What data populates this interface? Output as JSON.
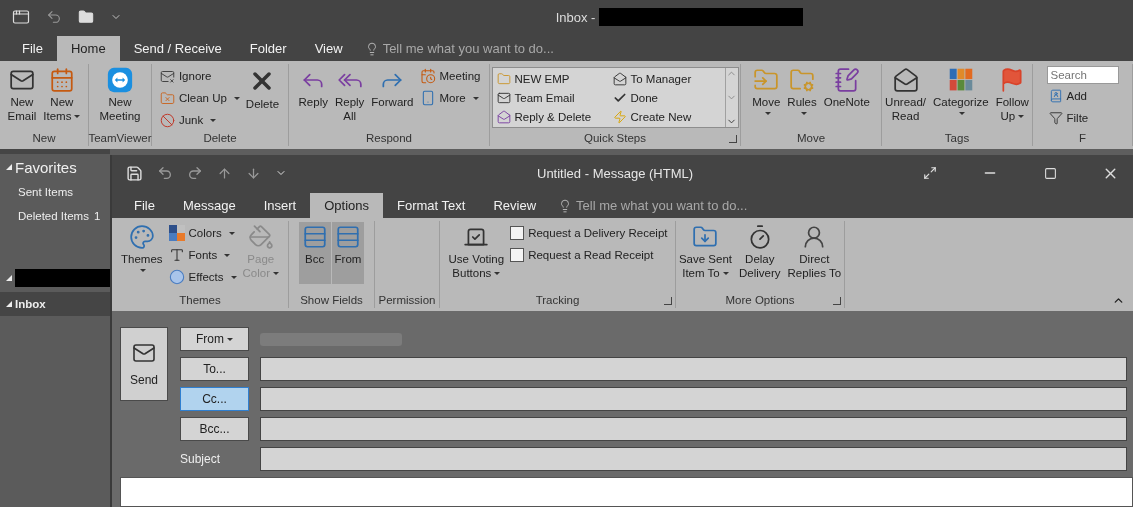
{
  "main_window": {
    "title": "Inbox -",
    "tabs": [
      {
        "label": "File",
        "selected": false
      },
      {
        "label": "Home",
        "selected": true
      },
      {
        "label": "Send / Receive",
        "selected": false
      },
      {
        "label": "Folder",
        "selected": false
      },
      {
        "label": "View",
        "selected": false
      }
    ],
    "tell_me": {
      "placeholder": "Tell me what you want to do..."
    },
    "ribbon": [
      {
        "label": "New",
        "items": [
          {
            "kind": "large",
            "label": "New\nEmail",
            "dropdown": false
          },
          {
            "kind": "large",
            "label": "New\nItems",
            "dropdown": true
          }
        ]
      },
      {
        "label": "TeamViewer",
        "items": [
          {
            "kind": "large",
            "label": "New\nMeeting",
            "dropdown": false
          }
        ]
      },
      {
        "label": "Delete",
        "items": [
          {
            "kind": "stack",
            "items": [
              {
                "label": "Ignore",
                "dropdown": false
              },
              {
                "label": "Clean Up",
                "dropdown": true
              },
              {
                "label": "Junk",
                "dropdown": true
              }
            ]
          },
          {
            "kind": "large",
            "label": "Delete",
            "dropdown": false
          }
        ]
      },
      {
        "label": "Respond",
        "items": [
          {
            "kind": "large",
            "label": "Reply",
            "dropdown": false
          },
          {
            "kind": "large",
            "label": "Reply\nAll",
            "dropdown": false
          },
          {
            "kind": "large",
            "label": "Forward",
            "dropdown": false
          },
          {
            "kind": "stack",
            "items": [
              {
                "label": "Meeting",
                "dropdown": false
              },
              {
                "label": "More",
                "dropdown": true
              }
            ]
          }
        ]
      },
      {
        "label": "Quick Steps",
        "launcher": true,
        "items": [
          {
            "kind": "gallery",
            "items": [
              {
                "label": "NEW EMP"
              },
              {
                "label": "To Manager"
              },
              {
                "label": "Team Email"
              },
              {
                "label": "Done"
              },
              {
                "label": "Reply & Delete"
              },
              {
                "label": "Create New"
              }
            ]
          }
        ]
      },
      {
        "label": "Move",
        "items": [
          {
            "kind": "large",
            "label": "Move",
            "dropdown": true
          },
          {
            "kind": "large",
            "label": "Rules",
            "dropdown": true
          },
          {
            "kind": "large",
            "label": "OneNote",
            "dropdown": false
          }
        ]
      },
      {
        "label": "Tags",
        "items": [
          {
            "kind": "large",
            "label": "Unread/\nRead",
            "dropdown": false
          },
          {
            "kind": "large",
            "label": "Categorize",
            "dropdown": true
          },
          {
            "kind": "large",
            "label": "Follow\nUp",
            "dropdown": true
          }
        ]
      },
      {
        "label": "F",
        "items": [
          {
            "kind": "stack",
            "items": [
              {
                "kind": "search",
                "placeholder": "Search"
              },
              {
                "label": "Add",
                "dropdown": false
              },
              {
                "label": "Filte",
                "dropdown": false
              }
            ]
          }
        ]
      }
    ]
  },
  "navigation": {
    "items": [
      {
        "kind": "header",
        "label": "Favorites",
        "expanded": true
      },
      {
        "kind": "folder",
        "label": "Sent Items",
        "selected": false
      },
      {
        "kind": "folder",
        "label": "Deleted Items",
        "count": "1",
        "selected": false
      },
      {
        "kind": "account",
        "expanded": true
      },
      {
        "kind": "folder",
        "label": "Inbox",
        "expanded": true,
        "selected": true
      }
    ]
  },
  "compose_window": {
    "title": "Untitled - Message (HTML)",
    "tabs": [
      {
        "label": "File",
        "selected": false
      },
      {
        "label": "Message",
        "selected": false
      },
      {
        "label": "Insert",
        "selected": false
      },
      {
        "label": "Options",
        "selected": true
      },
      {
        "label": "Format Text",
        "selected": false
      },
      {
        "label": "Review",
        "selected": false
      }
    ],
    "tell_me": {
      "placeholder": "Tell me what you want to do..."
    },
    "ribbon": [
      {
        "label": "Themes",
        "items": [
          {
            "kind": "large",
            "label": "Themes",
            "dropdown": true,
            "on": false,
            "disabled": false
          },
          {
            "kind": "stack",
            "items": [
              {
                "label": "Colors",
                "dropdown": true
              },
              {
                "label": "Fonts",
                "dropdown": true
              },
              {
                "label": "Effects",
                "dropdown": true
              }
            ]
          },
          {
            "kind": "large",
            "label": "Page\nColor",
            "dropdown": true,
            "on": false,
            "disabled": true
          }
        ]
      },
      {
        "label": "Show Fields",
        "items": [
          {
            "kind": "large",
            "label": "Bcc",
            "dropdown": false,
            "on": true,
            "disabled": false
          },
          {
            "kind": "large",
            "label": "From",
            "dropdown": false,
            "on": true,
            "disabled": false
          }
        ]
      },
      {
        "label": "Permission"
      },
      {
        "label": "Tracking",
        "launcher": true,
        "items": [
          {
            "kind": "large",
            "label": "Use Voting\nButtons",
            "dropdown": true,
            "on": false,
            "disabled": false
          },
          {
            "kind": "stack",
            "items": [
              {
                "kind": "checkbox",
                "label": "Request a Delivery Receipt",
                "checked": false
              },
              {
                "kind": "checkbox",
                "label": "Request a Read Receipt",
                "checked": false
              }
            ]
          }
        ]
      },
      {
        "label": "More Options",
        "launcher": true,
        "items": [
          {
            "kind": "large",
            "label": "Save Sent\nItem To",
            "dropdown": true,
            "on": false,
            "disabled": false
          },
          {
            "kind": "large",
            "label": "Delay\nDelivery",
            "dropdown": false,
            "on": false,
            "disabled": false
          },
          {
            "kind": "large",
            "label": "Direct\nReplies To",
            "dropdown": false,
            "on": false,
            "disabled": false
          }
        ]
      }
    ],
    "send": {
      "label": "Send"
    },
    "fields": [
      {
        "kind": "from",
        "button": "From",
        "dropdown": true,
        "focused": false
      },
      {
        "kind": "address",
        "button": "To...",
        "focused": false
      },
      {
        "kind": "address",
        "button": "Cc...",
        "focused": true
      },
      {
        "kind": "address",
        "button": "Bcc...",
        "focused": false
      },
      {
        "kind": "subject",
        "label": "Subject"
      }
    ]
  }
}
